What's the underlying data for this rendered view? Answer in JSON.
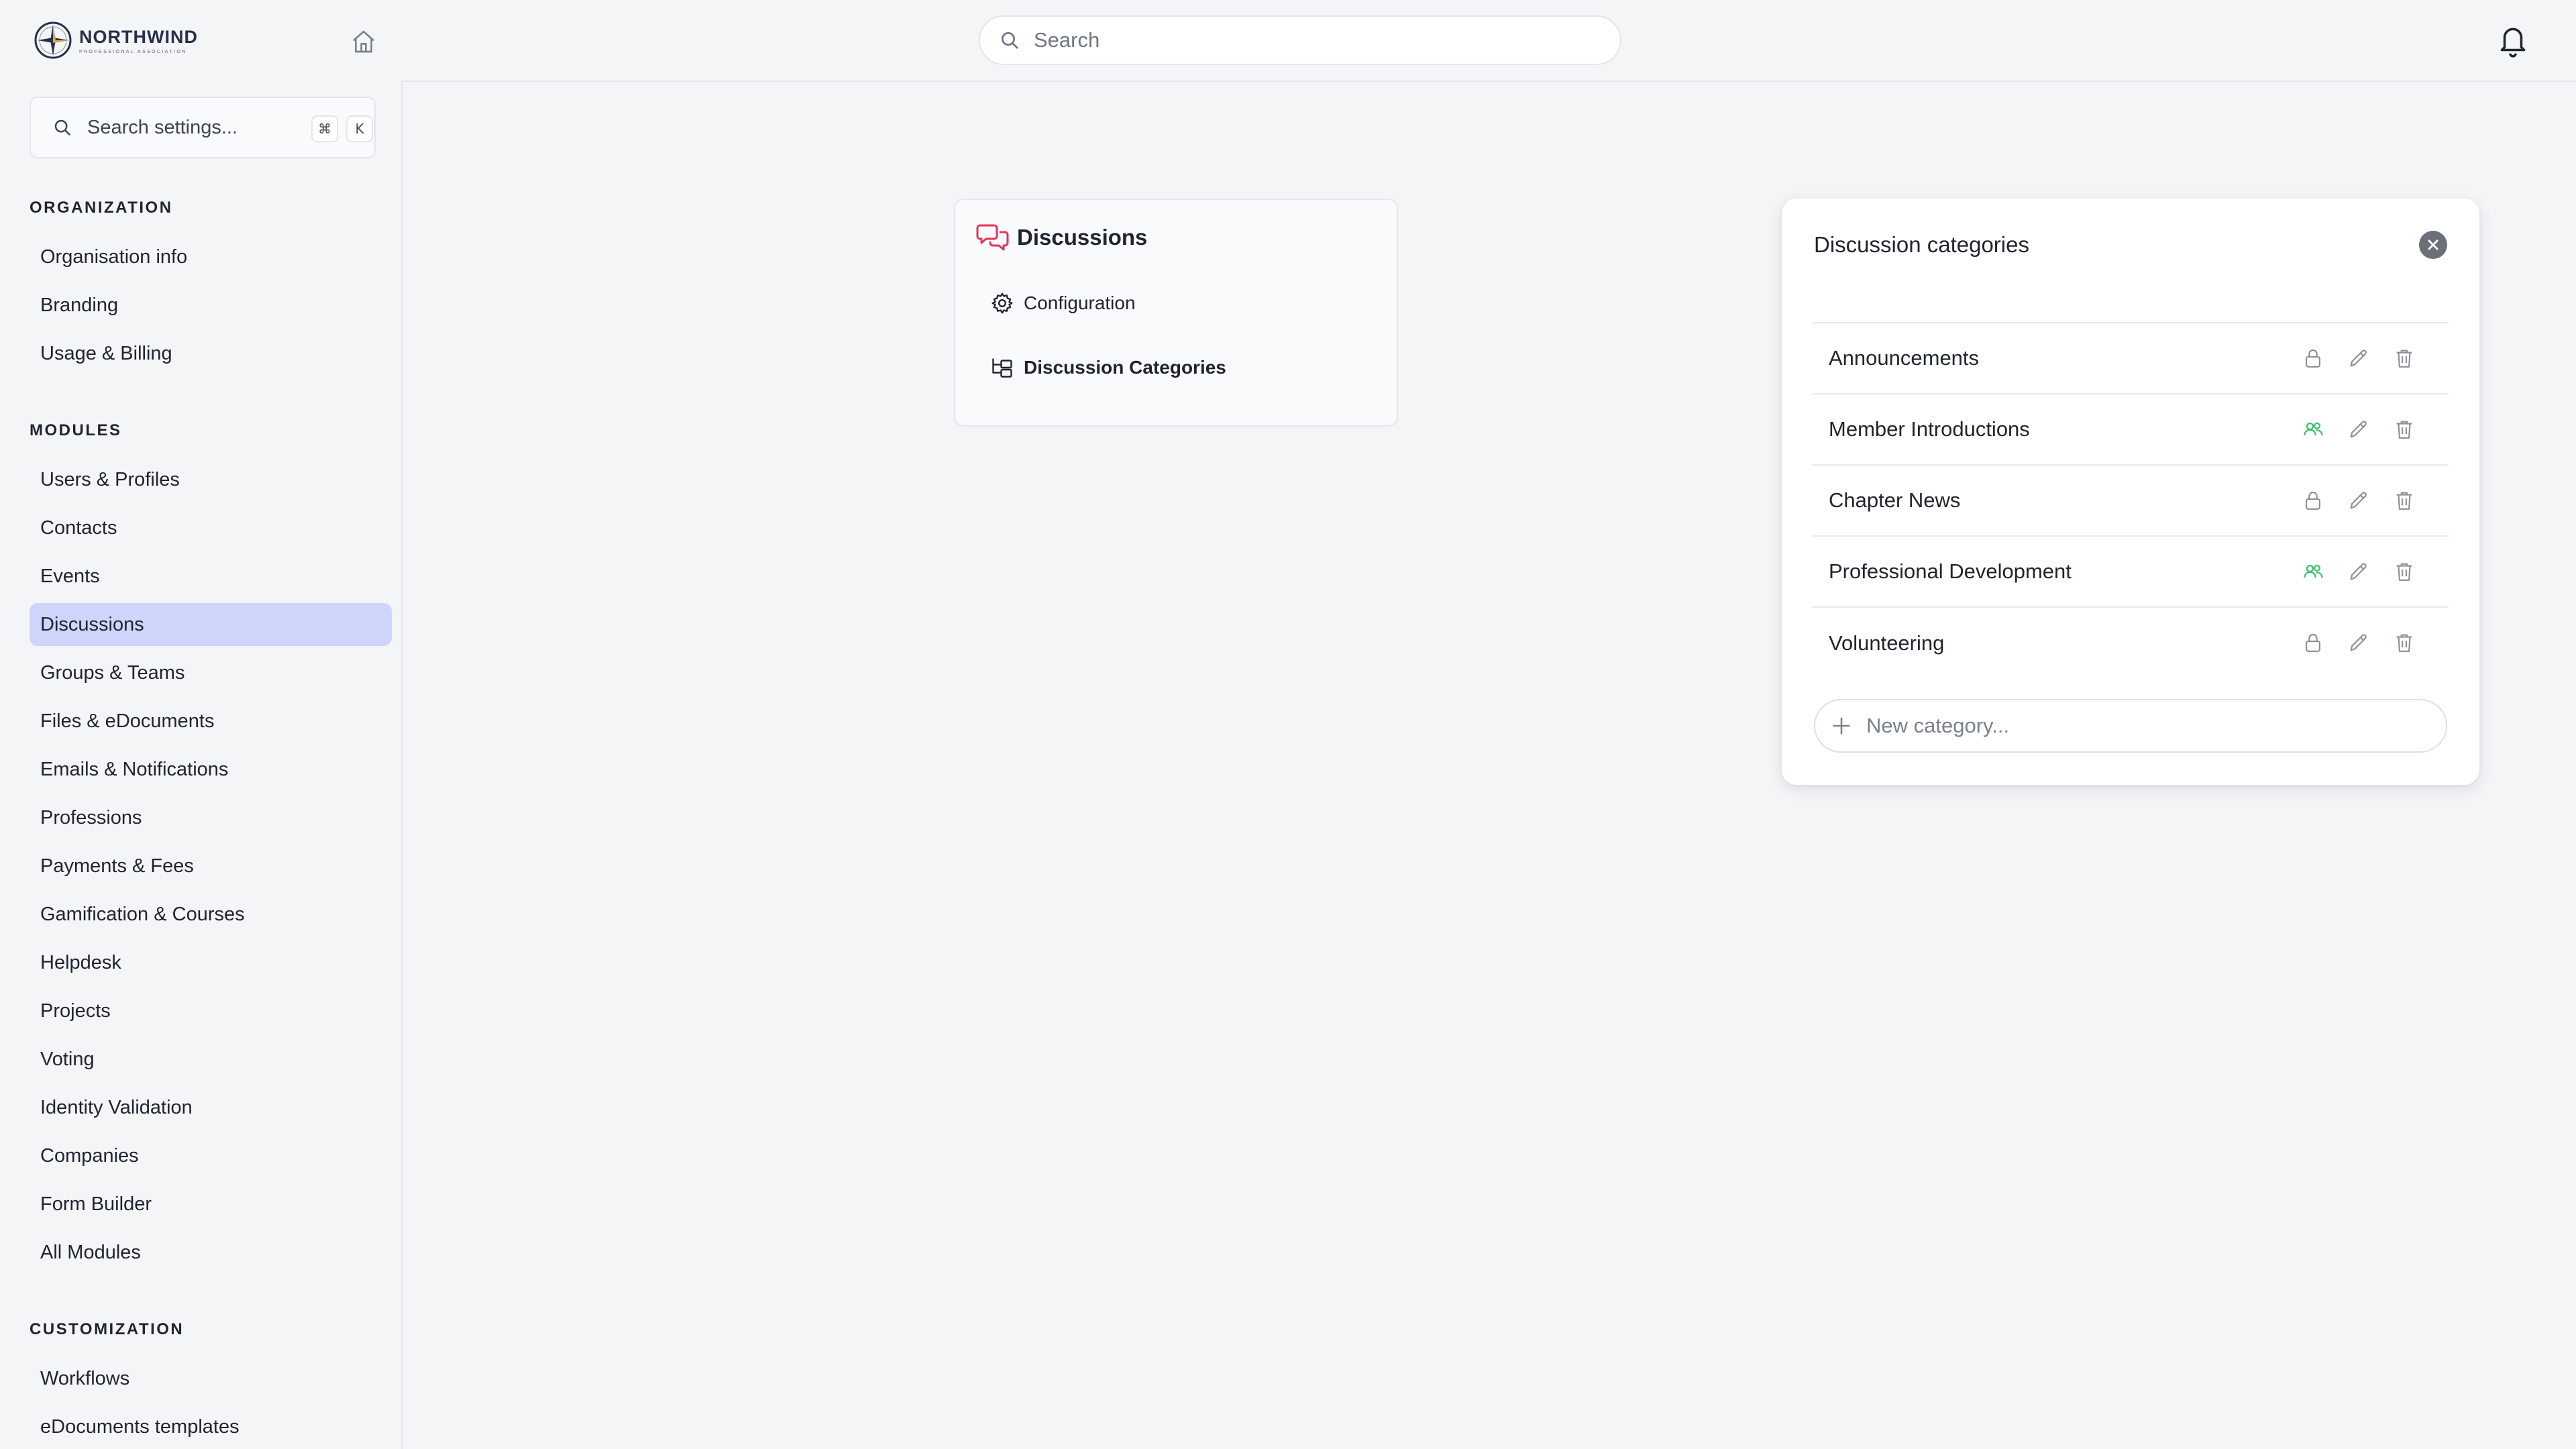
{
  "brand": {
    "name": "NORTHWIND",
    "tagline": "PROFESSIONAL ASSOCIATION"
  },
  "header": {
    "search_placeholder": "Search"
  },
  "sidebar": {
    "search_placeholder": "Search settings...",
    "shortcut": [
      "⌘",
      "K"
    ],
    "sections": [
      {
        "title": "ORGANIZATION",
        "items": [
          "Organisation info",
          "Branding",
          "Usage & Billing"
        ]
      },
      {
        "title": "MODULES",
        "items": [
          "Users & Profiles",
          "Contacts",
          "Events",
          "Discussions",
          "Groups & Teams",
          "Files & eDocuments",
          "Emails & Notifications",
          "Professions",
          "Payments & Fees",
          "Gamification & Courses",
          "Helpdesk",
          "Projects",
          "Voting",
          "Identity Validation",
          "Companies",
          "Form Builder",
          "All Modules"
        ]
      },
      {
        "title": "CUSTOMIZATION",
        "items": [
          "Workflows",
          "eDocuments templates"
        ]
      }
    ],
    "active_item": "Discussions"
  },
  "submenu": {
    "title": "Discussions",
    "items": [
      {
        "label": "Configuration",
        "icon": "gear-icon"
      },
      {
        "label": "Discussion Categories",
        "icon": "hierarchy-icon",
        "active": true
      }
    ]
  },
  "categories_panel": {
    "title": "Discussion categories",
    "new_placeholder": "New category...",
    "rows": [
      {
        "name": "Announcements",
        "visibility": "private"
      },
      {
        "name": "Member Introductions",
        "visibility": "members"
      },
      {
        "name": "Chapter News",
        "visibility": "private"
      },
      {
        "name": "Professional Development",
        "visibility": "members"
      },
      {
        "name": "Volunteering",
        "visibility": "private"
      }
    ]
  },
  "colors": {
    "accent_active": "#cdd5fb",
    "members_green": "#3fbf6a",
    "discussion_icon_red": "#e0345a"
  }
}
